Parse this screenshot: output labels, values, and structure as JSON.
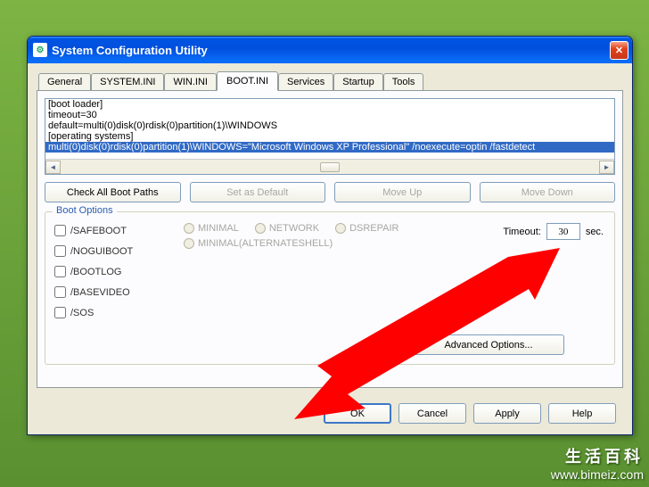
{
  "window": {
    "title": "System Configuration Utility"
  },
  "tabs": [
    "General",
    "SYSTEM.INI",
    "WIN.INI",
    "BOOT.INI",
    "Services",
    "Startup",
    "Tools"
  ],
  "active_tab_index": 3,
  "bootini": {
    "lines": [
      "[boot loader]",
      "timeout=30",
      "default=multi(0)disk(0)rdisk(0)partition(1)\\WINDOWS",
      "[operating systems]",
      "multi(0)disk(0)rdisk(0)partition(1)\\WINDOWS=\"Microsoft Windows XP Professional\" /noexecute=optin /fastdetect"
    ],
    "selected_index": 4
  },
  "buttons": {
    "check_paths": "Check All Boot Paths",
    "set_default": "Set as Default",
    "move_up": "Move Up",
    "move_down": "Move Down",
    "advanced": "Advanced Options...",
    "ok": "OK",
    "cancel": "Cancel",
    "apply": "Apply",
    "help": "Help"
  },
  "boot_options": {
    "legend": "Boot Options",
    "checks": [
      "/SAFEBOOT",
      "/NOGUIBOOT",
      "/BOOTLOG",
      "/BASEVIDEO",
      "/SOS"
    ],
    "radios_row1": [
      "MINIMAL",
      "NETWORK",
      "DSREPAIR"
    ],
    "radios_row2": [
      "MINIMAL(ALTERNATESHELL)"
    ]
  },
  "timeout": {
    "label": "Timeout:",
    "value": "30",
    "suffix": "sec."
  },
  "watermark": {
    "line1": "生活百科",
    "line2": "www.bimeiz.com"
  }
}
